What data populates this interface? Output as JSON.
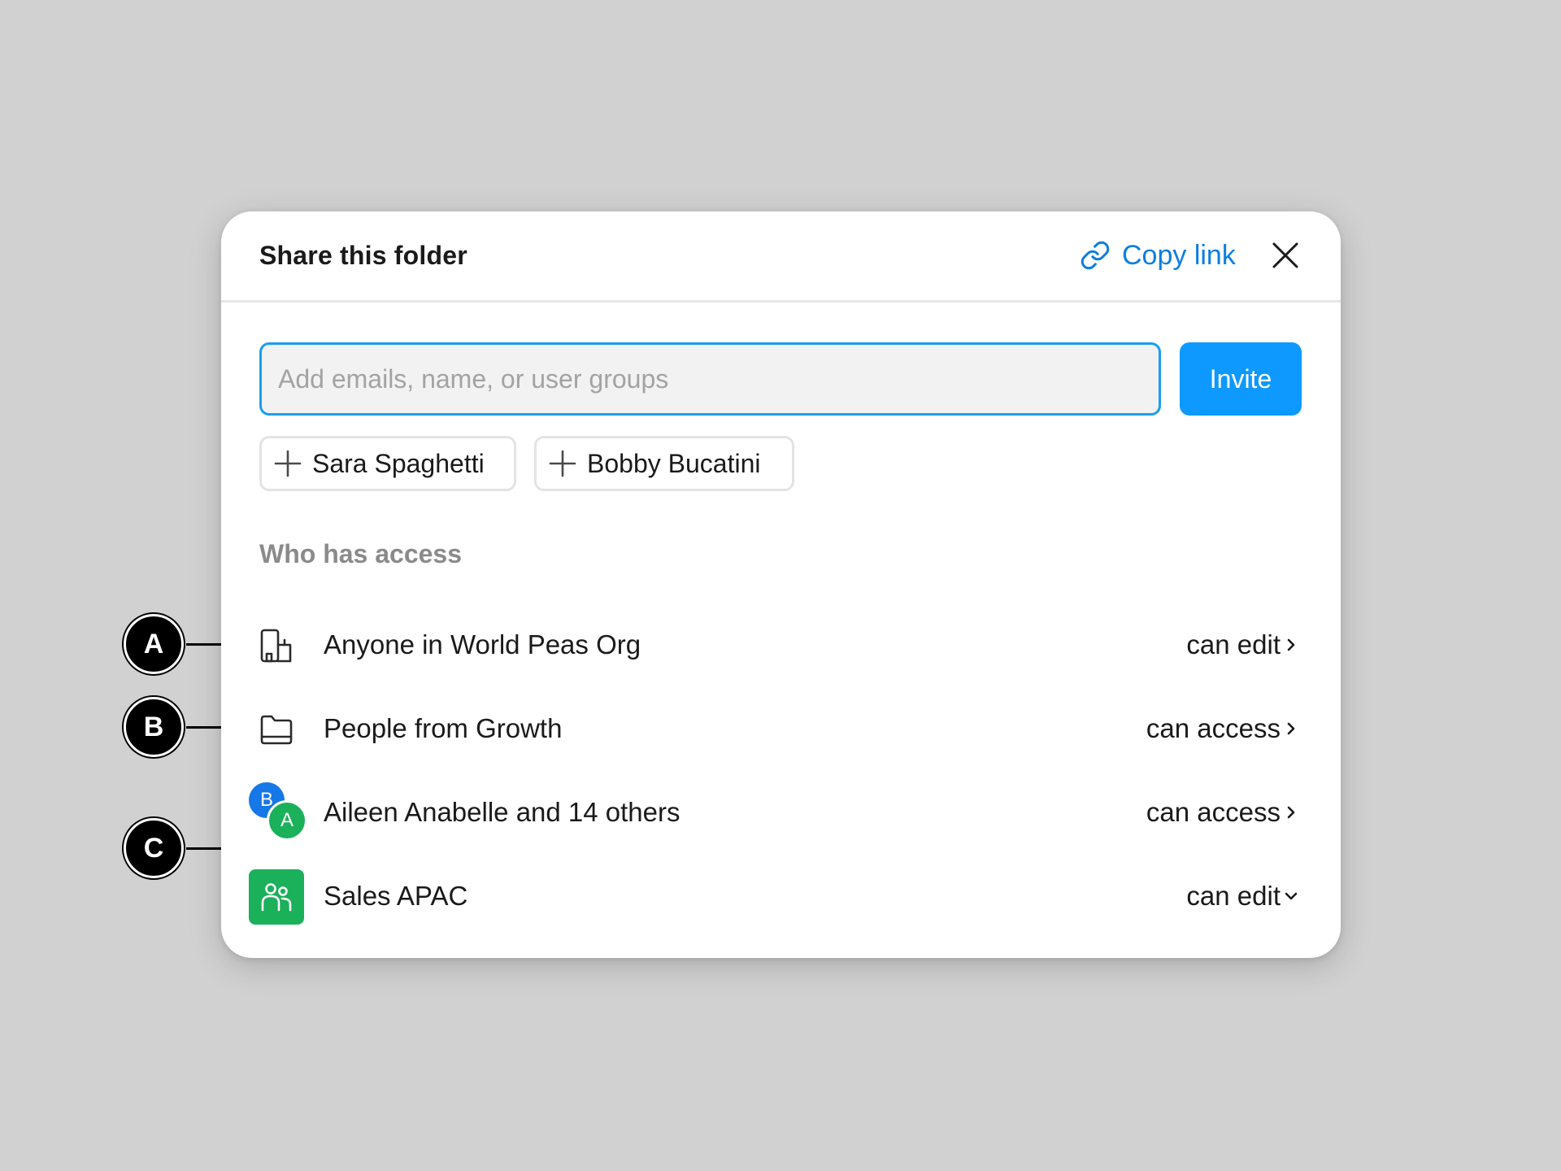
{
  "dialog": {
    "title": "Share this folder",
    "copy_link_label": "Copy link",
    "close_icon": "close-icon",
    "link_icon": "link-icon"
  },
  "invite": {
    "placeholder": "Add emails, name, or user groups",
    "value": "",
    "button_label": "Invite"
  },
  "suggestions": [
    {
      "name": "Sara Spaghetti",
      "icon": "plus-icon"
    },
    {
      "name": "Bobby Bucatini",
      "icon": "plus-icon"
    }
  ],
  "access": {
    "section_label": "Who has access",
    "rows": [
      {
        "icon": "building-icon",
        "name": "Anyone in World Peas Org",
        "permission": "can edit",
        "chevron": "chevron-right-icon"
      },
      {
        "icon": "folder-icon",
        "name": "People from Growth",
        "permission": "can access",
        "chevron": "chevron-right-icon"
      },
      {
        "icon": "avatar-stack",
        "avatars": [
          "B",
          "A"
        ],
        "name": "Aileen Anabelle and 14 others",
        "permission": "can access",
        "chevron": "chevron-right-icon"
      },
      {
        "icon": "user-group-icon",
        "name": "Sales APAC",
        "permission": "can edit",
        "chevron": "chevron-down-icon"
      }
    ]
  },
  "annotations": [
    "A",
    "B",
    "C"
  ],
  "colors": {
    "accent": "#0d99ff",
    "link": "#0d7ee0",
    "avatar_blue": "#1677e6",
    "avatar_green": "#1bb05a",
    "background": "#d1d1d1",
    "muted_text": "#8a8a8a"
  }
}
